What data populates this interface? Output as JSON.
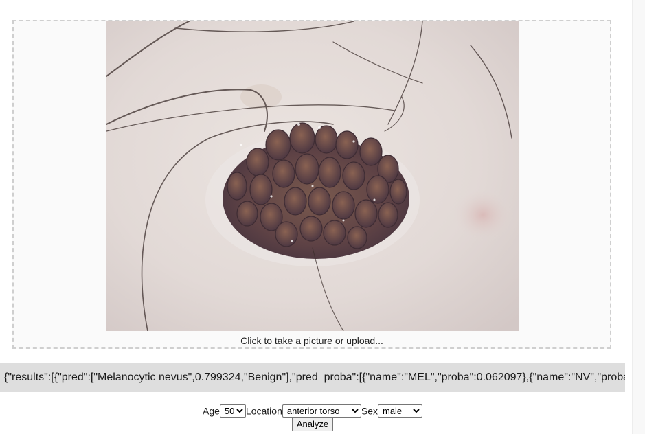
{
  "upload": {
    "caption": "Click to take a picture or upload..."
  },
  "result": {
    "text": "{\"results\":[{\"pred\":[\"Melanocytic nevus\",0.799324,\"Benign\"],\"pred_proba\":[{\"name\":\"MEL\",\"proba\":0.062097},{\"name\":\"NV\",\"proba\""
  },
  "form": {
    "age_label": "Age",
    "age_value": "50",
    "location_label": "Location",
    "location_value": "anterior torso",
    "sex_label": "Sex",
    "sex_value": "male",
    "analyze_label": "Analyze"
  }
}
